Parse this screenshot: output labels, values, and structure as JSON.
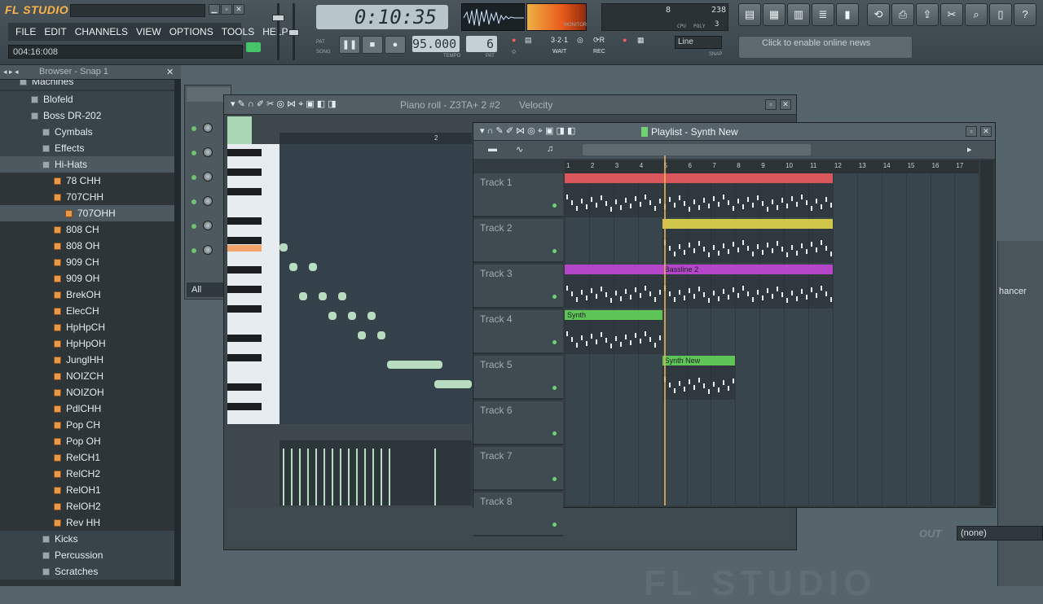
{
  "app": {
    "logo": "FL STUDIO",
    "hint": "004:16:008"
  },
  "menu": [
    "FILE",
    "EDIT",
    "CHANNELS",
    "VIEW",
    "OPTIONS",
    "TOOLS",
    "HELP"
  ],
  "transport": {
    "time": "0:10:35",
    "tempo": "95.000",
    "pattern": "6",
    "tempo_label": "TEMPO",
    "pattern_label": "PAT",
    "pat_label": "PAT",
    "song_label": "SONG",
    "monitor_label": "MONITOR"
  },
  "cpu": {
    "value1": "8",
    "value2": "238",
    "cpu_label": "CPU",
    "poly_label": "POLY",
    "poly_value": "3"
  },
  "snap": {
    "value": "Line",
    "label": "SNAP"
  },
  "mode_labels": {
    "wait": "WAIT",
    "rec": "REC"
  },
  "news": {
    "text": "Click to enable online news"
  },
  "browser": {
    "title": "Browser - Snap 1",
    "items": [
      {
        "label": "Machines",
        "type": "folder",
        "indent": 2
      },
      {
        "label": "Blofeld",
        "type": "folder",
        "indent": 3
      },
      {
        "label": "Boss DR-202",
        "type": "folder",
        "indent": 3
      },
      {
        "label": "Cymbals",
        "type": "folder",
        "indent": 4
      },
      {
        "label": "Effects",
        "type": "folder",
        "indent": 4
      },
      {
        "label": "Hi-Hats",
        "type": "folder",
        "indent": 4,
        "selected": true
      },
      {
        "label": "78 CHH",
        "type": "sample",
        "indent": 5
      },
      {
        "label": "707CHH",
        "type": "sample",
        "indent": 5
      },
      {
        "label": "707OHH",
        "type": "sample",
        "indent": 6,
        "selected": true
      },
      {
        "label": "808 CH",
        "type": "sample",
        "indent": 5
      },
      {
        "label": "808 OH",
        "type": "sample",
        "indent": 5
      },
      {
        "label": "909 CH",
        "type": "sample",
        "indent": 5
      },
      {
        "label": "909 OH",
        "type": "sample",
        "indent": 5
      },
      {
        "label": "BrekOH",
        "type": "sample",
        "indent": 5
      },
      {
        "label": "ElecCH",
        "type": "sample",
        "indent": 5
      },
      {
        "label": "HpHpCH",
        "type": "sample",
        "indent": 5
      },
      {
        "label": "HpHpOH",
        "type": "sample",
        "indent": 5
      },
      {
        "label": "JunglHH",
        "type": "sample",
        "indent": 5
      },
      {
        "label": "NOIZCH",
        "type": "sample",
        "indent": 5
      },
      {
        "label": "NOIZOH",
        "type": "sample",
        "indent": 5
      },
      {
        "label": "PdlCHH",
        "type": "sample",
        "indent": 5
      },
      {
        "label": "Pop CH",
        "type": "sample",
        "indent": 5
      },
      {
        "label": "Pop OH",
        "type": "sample",
        "indent": 5
      },
      {
        "label": "RelCH1",
        "type": "sample",
        "indent": 5
      },
      {
        "label": "RelCH2",
        "type": "sample",
        "indent": 5
      },
      {
        "label": "RelOH1",
        "type": "sample",
        "indent": 5
      },
      {
        "label": "RelOH2",
        "type": "sample",
        "indent": 5
      },
      {
        "label": "Rev HH",
        "type": "sample",
        "indent": 5
      },
      {
        "label": "Kicks",
        "type": "folder",
        "indent": 4
      },
      {
        "label": "Percussion",
        "type": "folder",
        "indent": 4
      },
      {
        "label": "Scratches",
        "type": "folder",
        "indent": 4
      }
    ]
  },
  "channel_rack": {
    "filter_label": "All"
  },
  "piano_roll": {
    "title": "Piano roll - Z3TA+ 2 #2",
    "param": "Velocity",
    "bar_label": "2"
  },
  "playlist": {
    "title": "Playlist - Synth New",
    "ruler": [
      "1",
      "2",
      "3",
      "4",
      "5",
      "6",
      "7",
      "8",
      "9",
      "10",
      "11",
      "12",
      "13",
      "14",
      "15",
      "16",
      "17"
    ],
    "tracks": [
      "Track 1",
      "Track 2",
      "Track 3",
      "Track 4",
      "Track 5",
      "Track 6",
      "Track 7",
      "Track 8"
    ],
    "clips": [
      {
        "track": 0,
        "start": 1,
        "end": 12,
        "label": "",
        "color": "#d9575c"
      },
      {
        "track": 1,
        "start": 5,
        "end": 12,
        "label": "",
        "color": "#cfc64a"
      },
      {
        "track": 2,
        "start": 1,
        "end": 5,
        "label": "",
        "color": "#b646c9"
      },
      {
        "track": 2,
        "start": 5,
        "end": 12,
        "label": "Bassline 2",
        "color": "#b646c9"
      },
      {
        "track": 3,
        "start": 1,
        "end": 5,
        "label": "Synth",
        "color": "#5fc456"
      },
      {
        "track": 4,
        "start": 5,
        "end": 8,
        "label": "Synth New",
        "color": "#5fc456"
      }
    ]
  },
  "mixer": {
    "slot_label": "hancer",
    "out_label": "OUT",
    "out_value": "(none)"
  },
  "watermark": "FL STUDIO"
}
